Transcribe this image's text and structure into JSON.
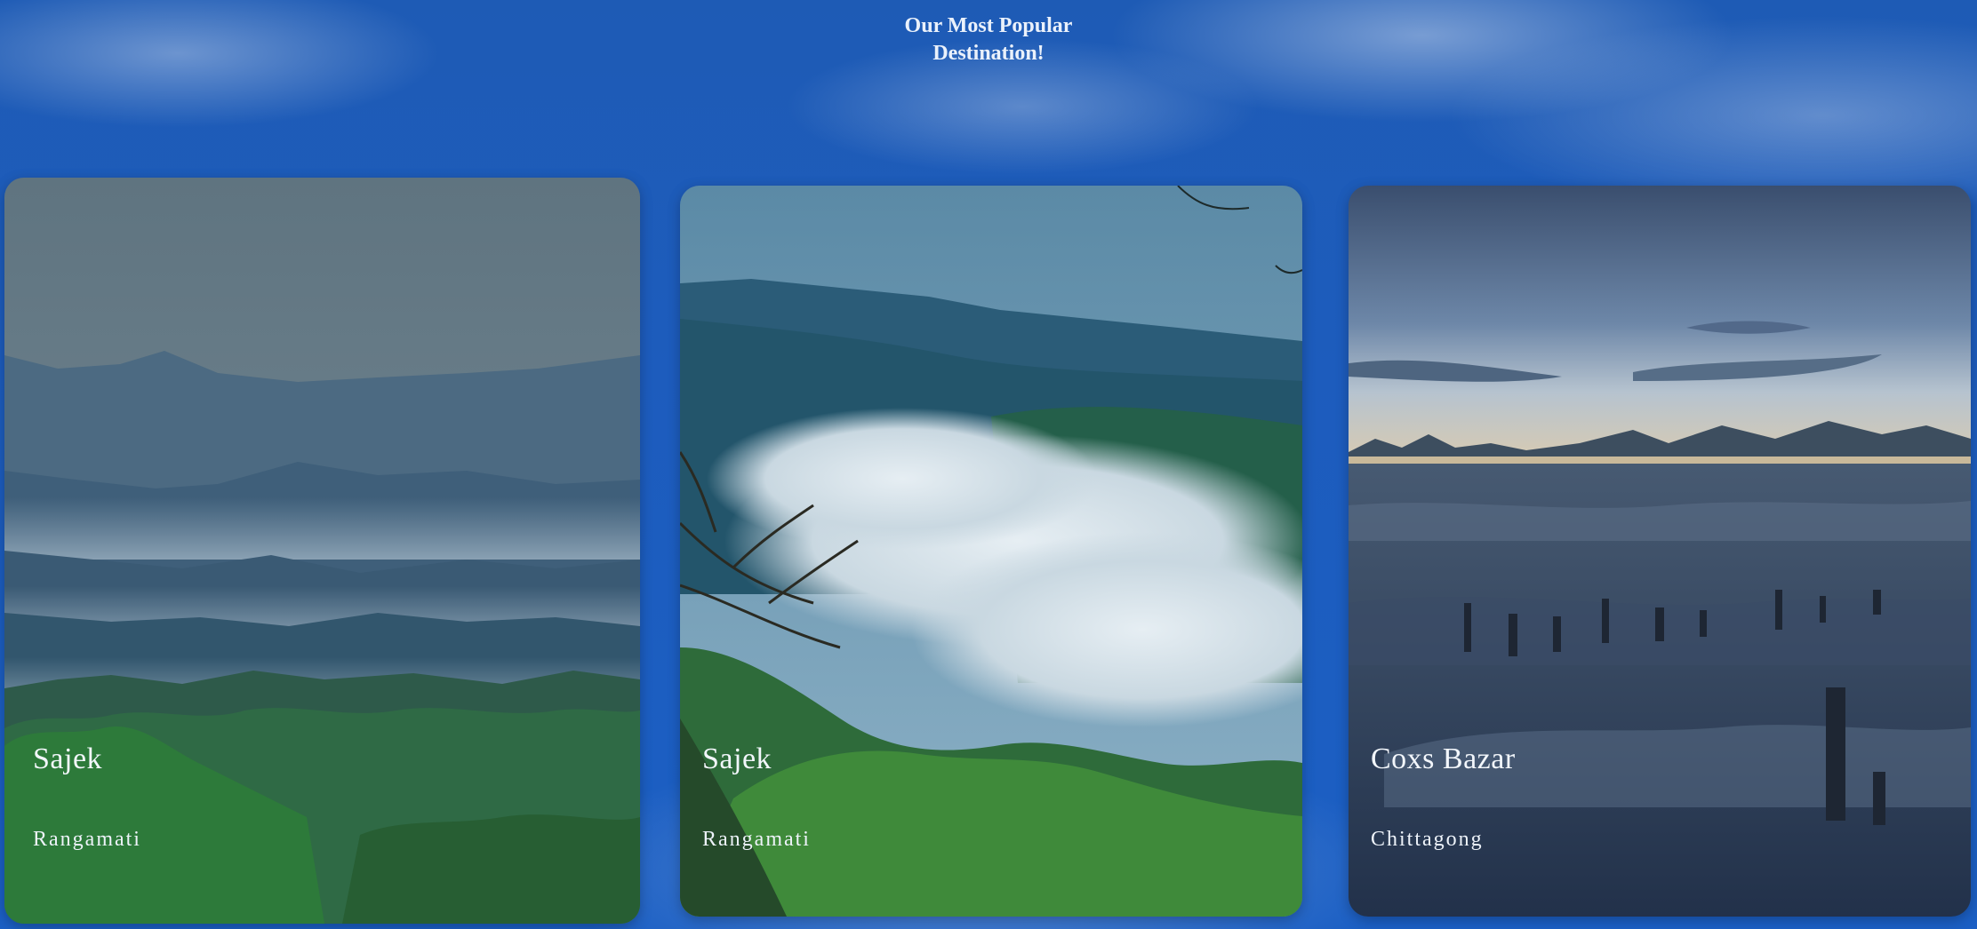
{
  "page": {
    "title_line1": "Our Most Popular",
    "title_line2": "Destination!"
  },
  "destinations": [
    {
      "name": "Sajek",
      "region": "Rangamati",
      "scene": "misty-hills"
    },
    {
      "name": "Sajek",
      "region": "Rangamati",
      "scene": "cloud-valley"
    },
    {
      "name": "Coxs Bazar",
      "region": "Chittagong",
      "scene": "beach-dusk"
    }
  ],
  "colors": {
    "background": "#1d5cbd",
    "title_text": "#eaf1fb",
    "card_text": "#f2f6fb"
  }
}
